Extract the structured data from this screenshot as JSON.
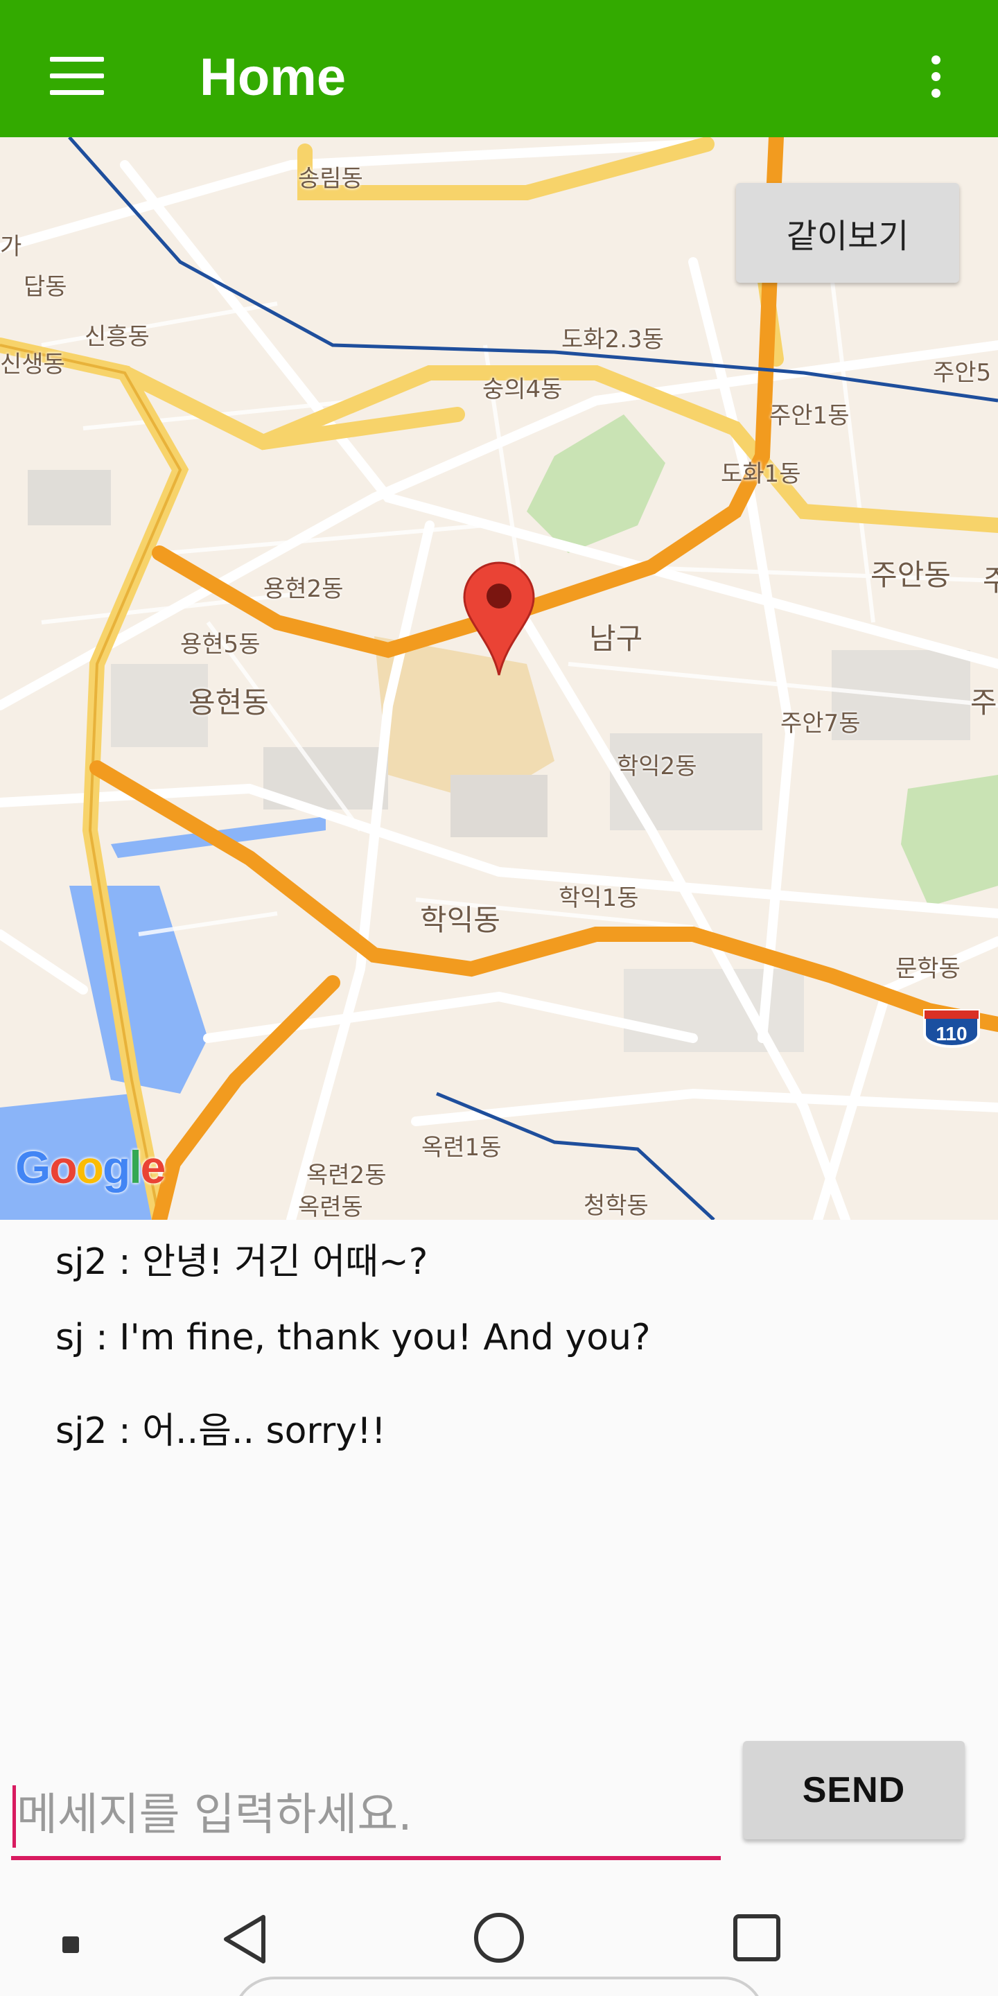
{
  "app_bar": {
    "title": "Home",
    "menu_icon": "hamburger-menu-icon",
    "overflow_icon": "more-vert-icon",
    "color": "#33aa00"
  },
  "map": {
    "view_together_button": "같이보기",
    "logo_text": "Google",
    "route_shield": "110",
    "marker_icon": "map-pin-icon",
    "labels": [
      "송림동",
      "가",
      "답동",
      "신흥동",
      "신생동",
      "도화2.3동",
      "숭의4동",
      "주안5",
      "주안1동",
      "도화1동",
      "주안동",
      "주",
      "용현2동",
      "용현5동",
      "용현동",
      "남구",
      "주안7동",
      "주",
      "학익2동",
      "학익1동",
      "학익동",
      "문학동",
      "옥련1동",
      "옥련2동",
      "옥련동",
      "청학동"
    ]
  },
  "chat": {
    "messages": [
      "sj2 : 안녕! 거긴 어때~?",
      "sj : I'm fine, thank you! And you?",
      "sj2 : 어..음.. sorry!!"
    ]
  },
  "composer": {
    "placeholder": "메세지를 입력하세요.",
    "value": "",
    "send_label": "SEND",
    "accent": "#d81b60"
  },
  "navbar": {
    "back_icon": "back-triangle-icon",
    "home_icon": "home-circle-icon",
    "recents_icon": "recents-square-icon",
    "notification_icon": "notification-dot-icon"
  }
}
